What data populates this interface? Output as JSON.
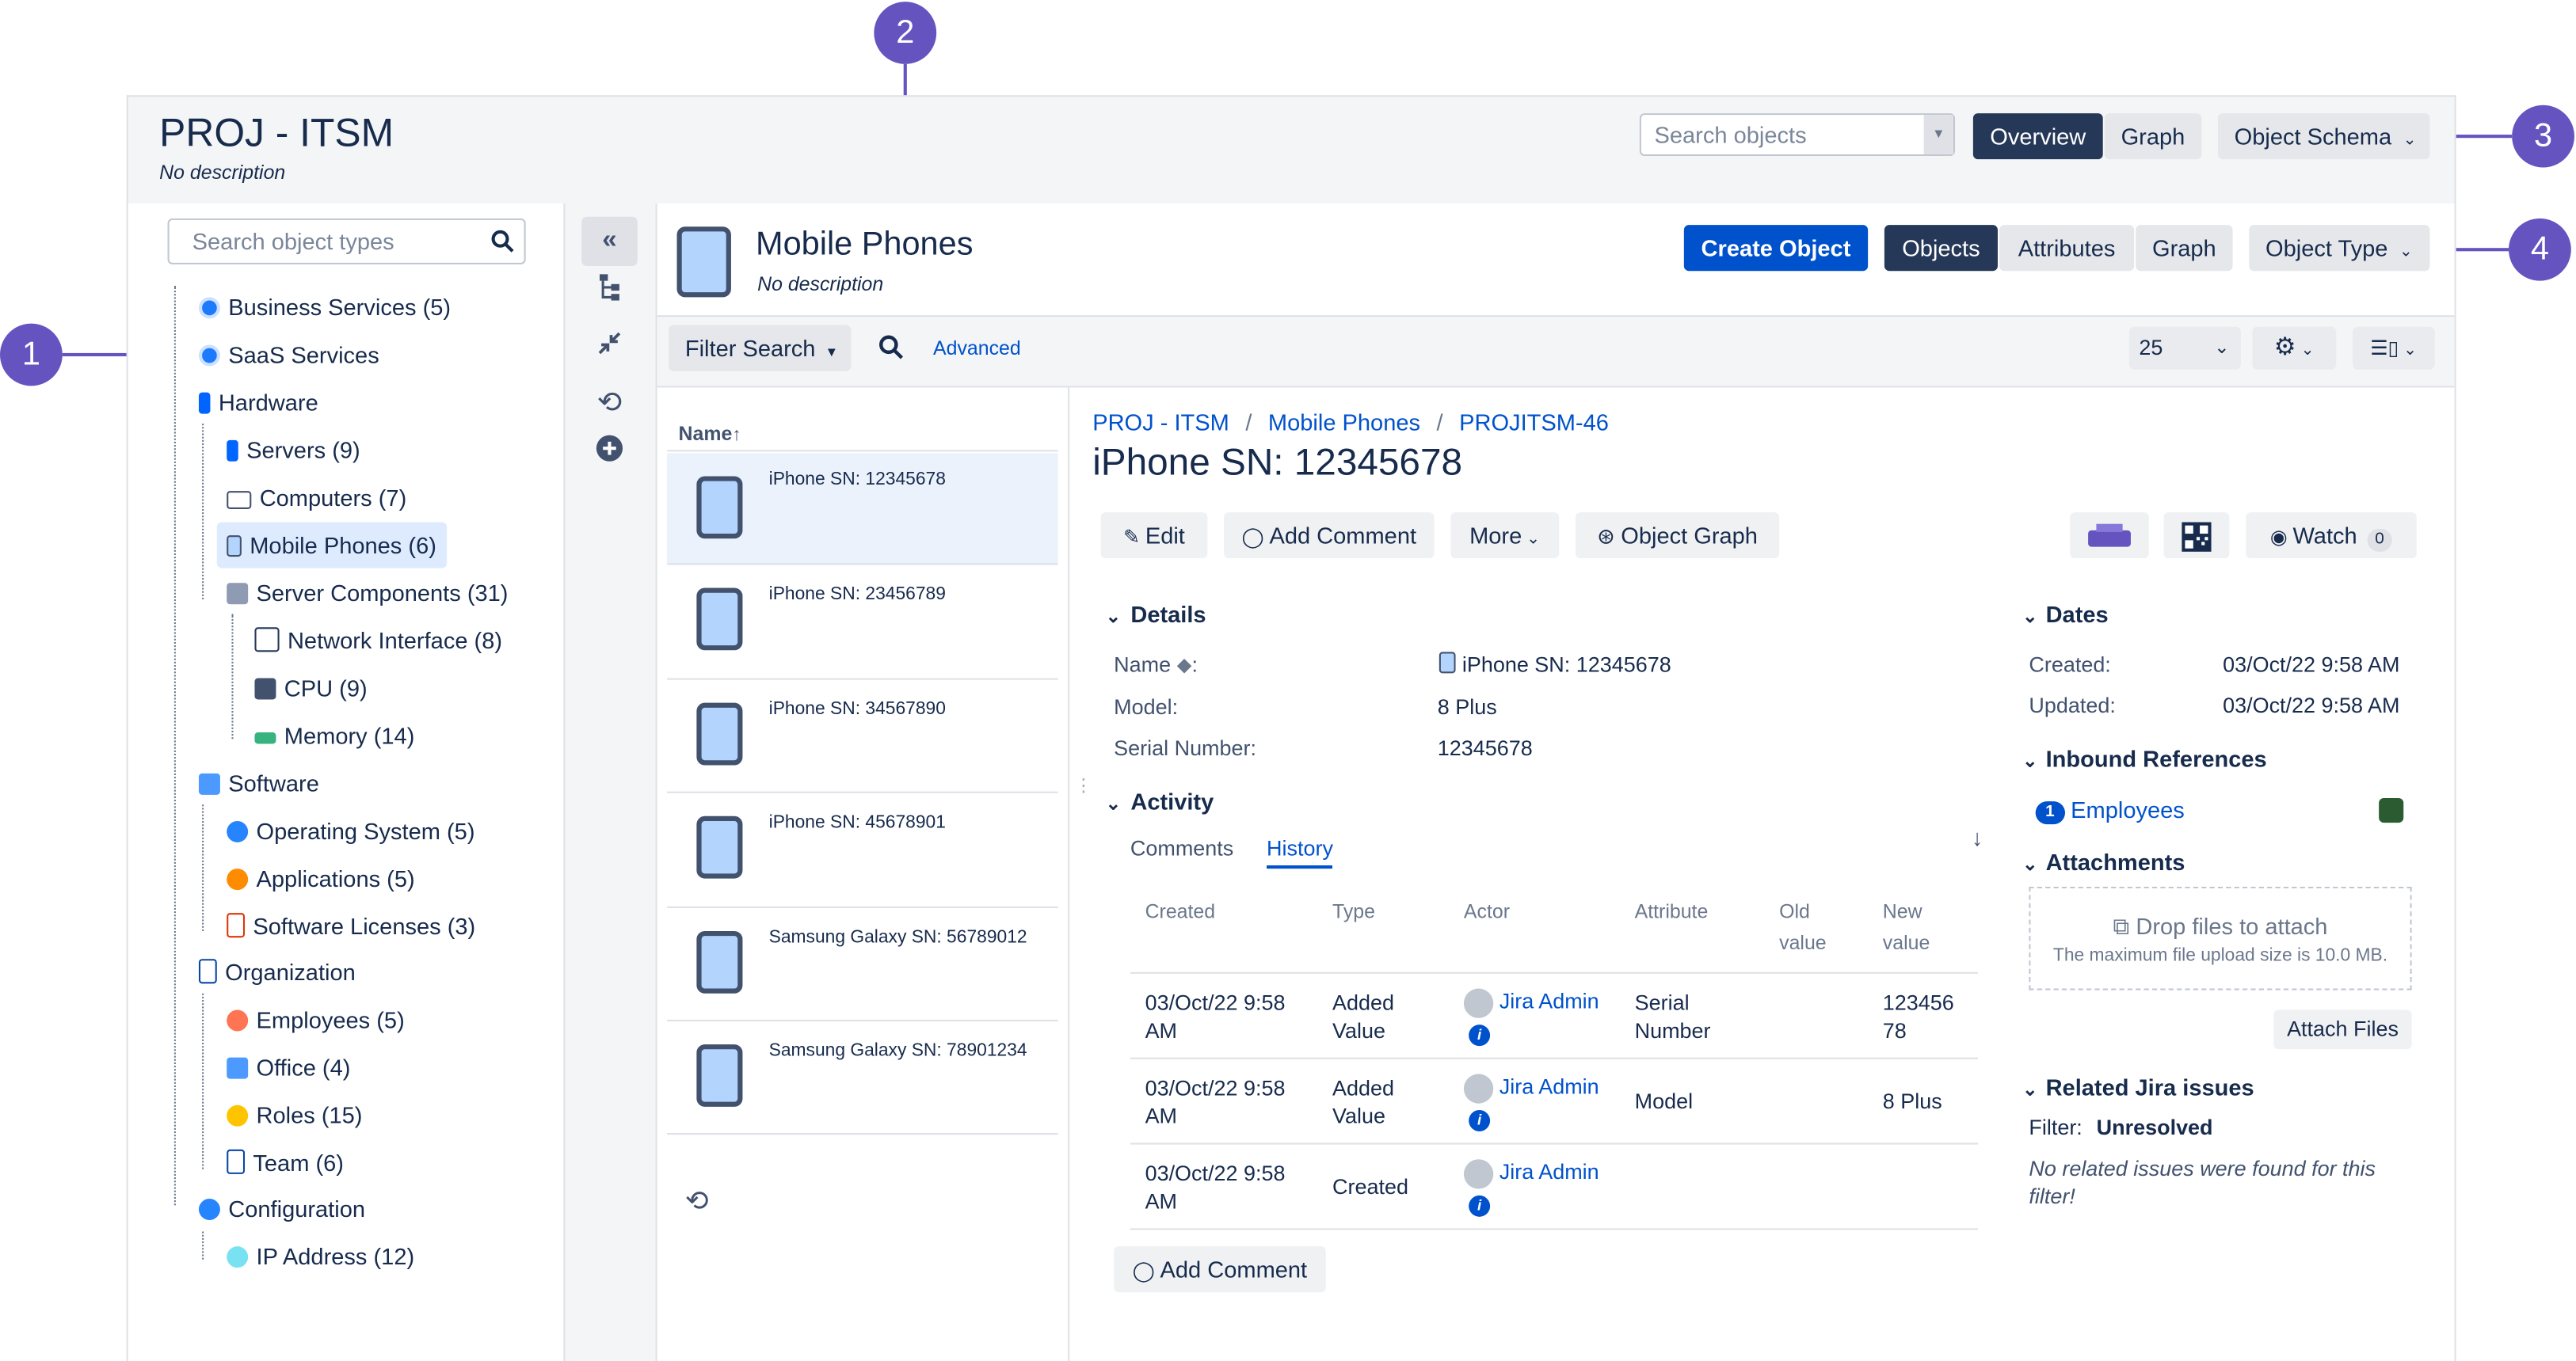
{
  "schema": {
    "title": "PROJ - ITSM",
    "description": "No description"
  },
  "header": {
    "search_placeholder": "Search objects",
    "overview": "Overview",
    "graph": "Graph",
    "object_schema": "Object Schema"
  },
  "callouts": [
    "1",
    "2",
    "3",
    "4"
  ],
  "tree": {
    "search_placeholder": "Search object types",
    "items": [
      {
        "label": "Business Services (5)",
        "icon": "service-icon"
      },
      {
        "label": "SaaS Services",
        "icon": "service-icon"
      },
      {
        "label": "Hardware",
        "icon": "hardware-icon"
      },
      {
        "label": "Servers (9)",
        "icon": "server-icon"
      },
      {
        "label": "Computers (7)",
        "icon": "computer-icon"
      },
      {
        "label": "Mobile Phones (6)",
        "icon": "phone-icon"
      },
      {
        "label": "Server Components (31)",
        "icon": "component-icon"
      },
      {
        "label": "Network Interface (8)",
        "icon": "network-icon"
      },
      {
        "label": "CPU (9)",
        "icon": "cpu-icon"
      },
      {
        "label": "Memory (14)",
        "icon": "memory-icon"
      },
      {
        "label": "Software",
        "icon": "software-icon"
      },
      {
        "label": "Operating System (5)",
        "icon": "os-icon"
      },
      {
        "label": "Applications (5)",
        "icon": "applications-icon"
      },
      {
        "label": "Software Licenses (3)",
        "icon": "license-icon"
      },
      {
        "label": "Organization",
        "icon": "organization-icon"
      },
      {
        "label": "Employees (5)",
        "icon": "employees-icon"
      },
      {
        "label": "Office (4)",
        "icon": "office-icon"
      },
      {
        "label": "Roles (15)",
        "icon": "roles-icon"
      },
      {
        "label": "Team (6)",
        "icon": "team-icon"
      },
      {
        "label": "Configuration",
        "icon": "configuration-icon"
      },
      {
        "label": "IP Address (12)",
        "icon": "ip-address-icon"
      }
    ]
  },
  "object_type": {
    "name": "Mobile Phones",
    "description": "No description",
    "create": "Create Object",
    "objects": "Objects",
    "attributes": "Attributes",
    "graph": "Graph",
    "object_type": "Object Type"
  },
  "filter": {
    "filter_search": "Filter Search",
    "advanced": "Advanced",
    "page_size": "25"
  },
  "list": {
    "header": "Name",
    "items": [
      "iPhone SN: 12345678",
      "iPhone SN: 23456789",
      "iPhone SN: 34567890",
      "iPhone SN: 45678901",
      "Samsung Galaxy SN: 56789012",
      "Samsung Galaxy SN: 78901234"
    ]
  },
  "detail": {
    "breadcrumb": [
      "PROJ - ITSM",
      "Mobile Phones",
      "PROJITSM-46"
    ],
    "title": "iPhone SN: 12345678",
    "actions": {
      "edit": "Edit",
      "add_comment": "Add Comment",
      "more": "More",
      "object_graph": "Object Graph",
      "watch": "Watch",
      "watch_count": "0"
    },
    "details": {
      "heading": "Details",
      "name_label": "Name",
      "name_value": "iPhone SN: 12345678",
      "model_label": "Model:",
      "model_value": "8 Plus",
      "serial_label": "Serial Number:",
      "serial_value": "12345678"
    },
    "activity": {
      "heading": "Activity",
      "tab_comments": "Comments",
      "tab_history": "History",
      "columns": [
        "Created",
        "Type",
        "Actor",
        "Attribute",
        "Old value",
        "New value"
      ],
      "rows": [
        {
          "created": "03/Oct/22 9:58 AM",
          "type": "Added Value",
          "actor": "Jira Admin",
          "attribute": "Serial Number",
          "old": "",
          "new": "12345678"
        },
        {
          "created": "03/Oct/22 9:58 AM",
          "type": "Added Value",
          "actor": "Jira Admin",
          "attribute": "Model",
          "old": "",
          "new": "8 Plus"
        },
        {
          "created": "03/Oct/22 9:58 AM",
          "type": "Created",
          "actor": "Jira Admin",
          "attribute": "",
          "old": "",
          "new": ""
        }
      ],
      "add_comment": "Add Comment"
    },
    "dates": {
      "heading": "Dates",
      "created_label": "Created:",
      "created_value": "03/Oct/22 9:58 AM",
      "updated_label": "Updated:",
      "updated_value": "03/Oct/22 9:58 AM"
    },
    "inbound": {
      "heading": "Inbound References",
      "count": "1",
      "label": "Employees"
    },
    "attachments": {
      "heading": "Attachments",
      "drop": "Drop files to attach",
      "max": "The maximum file upload size is 10.0 MB.",
      "attach_button": "Attach Files"
    },
    "related": {
      "heading": "Related Jira issues",
      "filter_label": "Filter:",
      "filter_value": "Unresolved",
      "empty": "No related issues were found for this filter!"
    }
  },
  "colors": {
    "callout": "#6554c0",
    "primary": "#0052cc",
    "dark_button": "#253858"
  }
}
